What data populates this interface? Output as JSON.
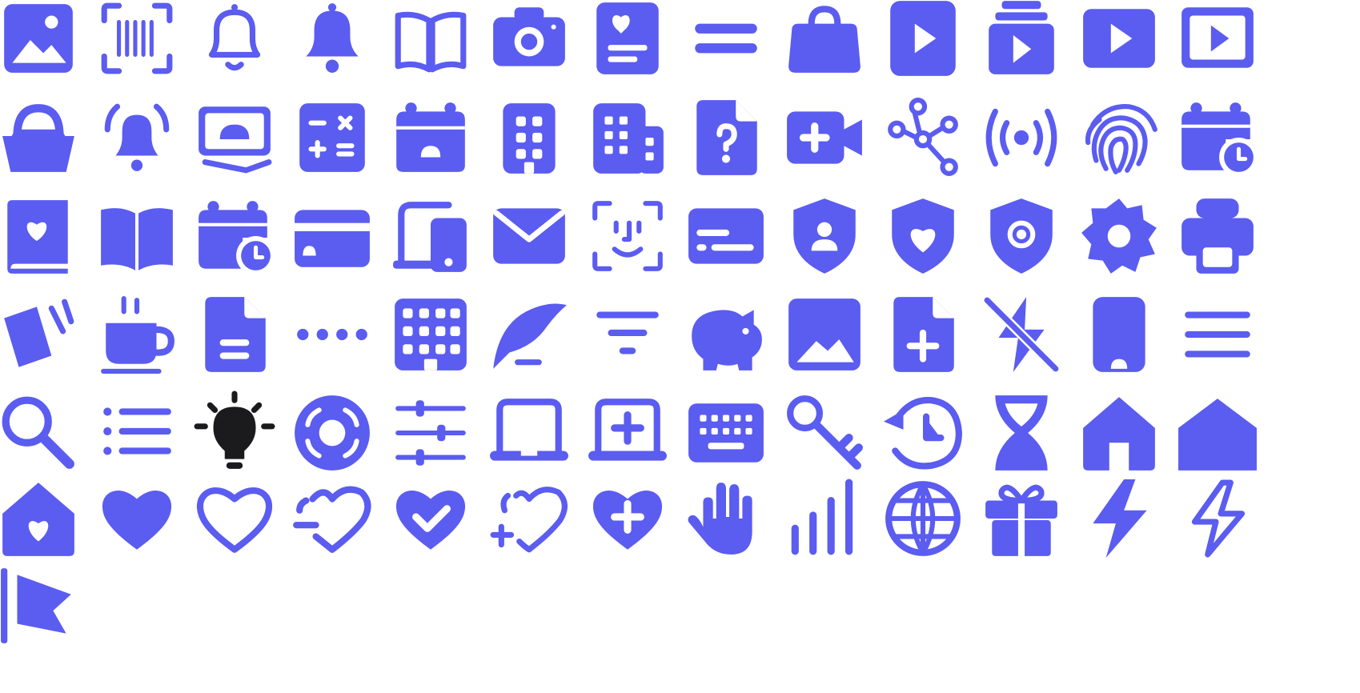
{
  "accent": "#5B5CF0",
  "highlight": "#1B1B1E",
  "icons": [
    "image-icon",
    "barcode-scan-icon",
    "bell-outline-icon",
    "bell-icon",
    "book-open-outline-icon",
    "camera-icon",
    "id-card-heart-icon",
    "equals-icon",
    "bag-icon",
    "phone-play-icon",
    "stacked-play-icon",
    "video-play-icon",
    "video-frame-play-icon",
    "basket-icon",
    "bell-ringing-icon",
    "banknote-icon",
    "calculator-icon",
    "calendar-icon",
    "building-icon",
    "buildings-icon",
    "file-question-icon",
    "video-add-icon",
    "share-nodes-icon",
    "broadcast-icon",
    "fingerprint-icon",
    "calendar-clock-icon",
    "book-heart-icon",
    "book-open-icon",
    "calendar-clock-icon",
    "credit-card-icon",
    "devices-icon",
    "mail-icon",
    "face-scan-icon",
    "id-card-icon",
    "shield-user-icon",
    "shield-heart-icon",
    "shield-gear-icon",
    "gear-icon",
    "printer-icon",
    "cards-icon",
    "coffee-cup-icon",
    "file-text-icon",
    "more-dots-icon",
    "building-wide-icon",
    "feather-sign-icon",
    "filter-icon",
    "piggy-bank-icon",
    "image-square-icon",
    "file-plus-icon",
    "flash-off-icon",
    "phone-icon",
    "menu-icon",
    "search-icon",
    "list-icon",
    "lightbulb-icon",
    "lifebuoy-icon",
    "sliders-icon",
    "laptop-icon",
    "laptop-plus-icon",
    "keyboard-icon",
    "key-icon",
    "history-icon",
    "hourglass-icon",
    "home-icon",
    "home-wide-icon",
    "home-heart-icon",
    "heart-icon",
    "heart-outline-icon",
    "heart-minus-icon",
    "heart-check-icon",
    "heart-add-outline-icon",
    "heart-plus-icon",
    "hand-icon",
    "signal-bars-icon",
    "globe-icon",
    "gift-icon",
    "lightning-icon",
    "lightning-outline-icon",
    "flag-icon"
  ]
}
